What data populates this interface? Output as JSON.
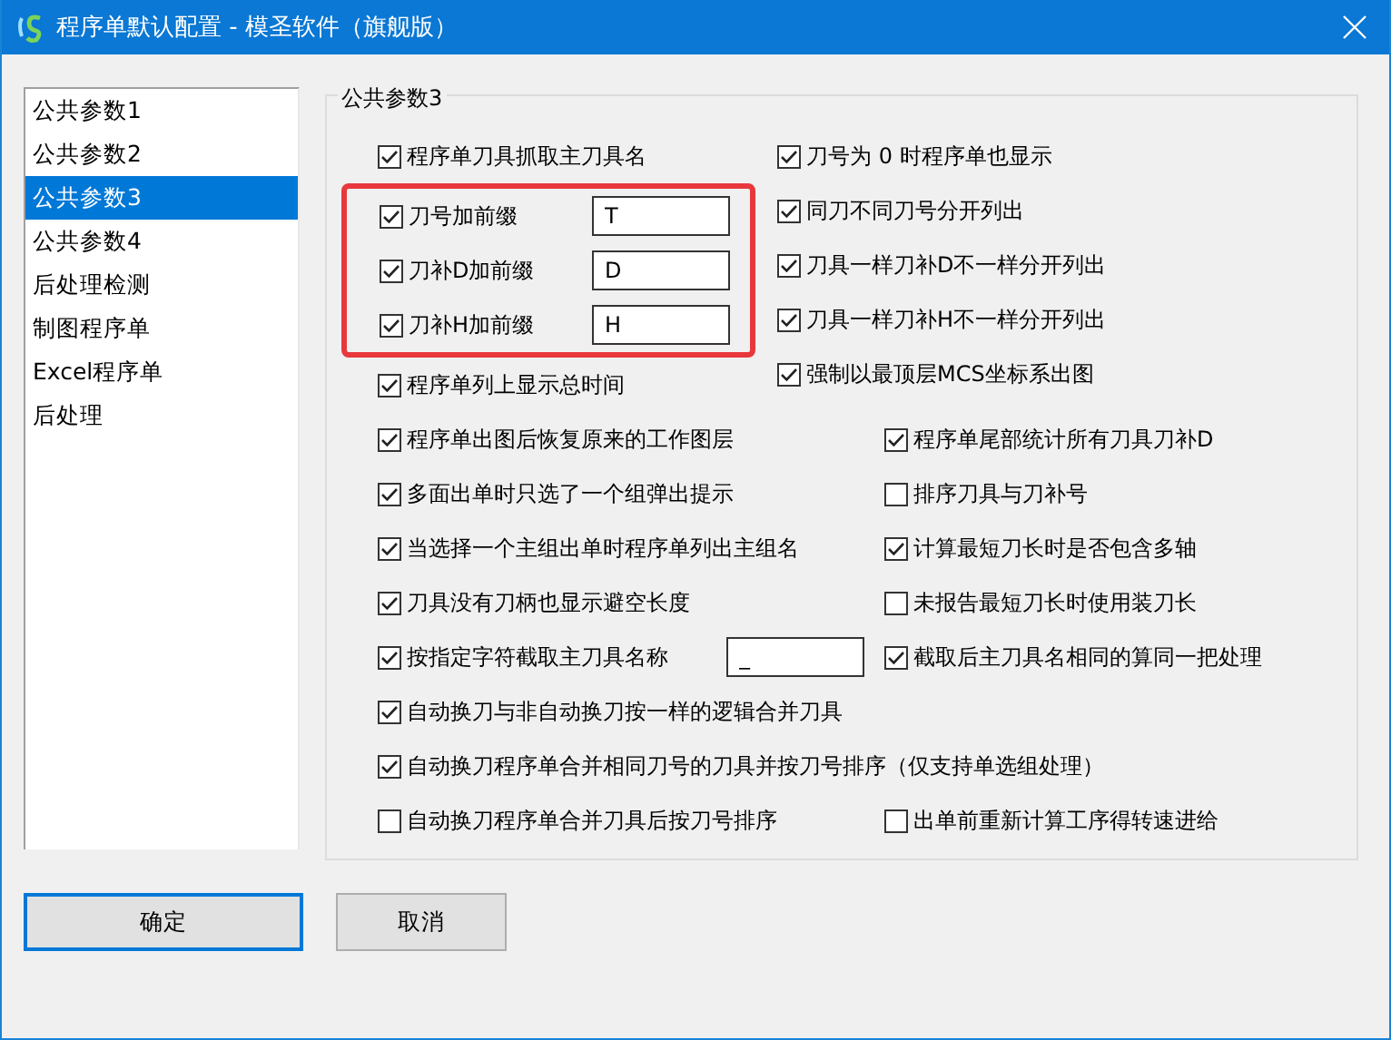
{
  "window": {
    "title": "程序单默认配置 - 模圣软件（旗舰版）"
  },
  "sidebar": {
    "items": [
      {
        "label": "公共参数1",
        "selected": false
      },
      {
        "label": "公共参数2",
        "selected": false
      },
      {
        "label": "公共参数3",
        "selected": true
      },
      {
        "label": "公共参数4",
        "selected": false
      },
      {
        "label": "后处理检测",
        "selected": false
      },
      {
        "label": "制图程序单",
        "selected": false
      },
      {
        "label": "Excel程序单",
        "selected": false
      },
      {
        "label": "后处理",
        "selected": false
      }
    ]
  },
  "group": {
    "title": "公共参数3",
    "top": {
      "left_before": [
        {
          "label": "程序单刀具抓取主刀具名",
          "checked": true
        }
      ],
      "prefix_box": {
        "outlined": true,
        "items": [
          {
            "label": "刀号加前缀",
            "checked": true,
            "value": "T"
          },
          {
            "label": "刀补D加前缀",
            "checked": true,
            "value": "D"
          },
          {
            "label": "刀补H加前缀",
            "checked": true,
            "value": "H"
          }
        ]
      },
      "left_after": [
        {
          "label": "程序单列上显示总时间",
          "checked": true
        }
      ],
      "right": [
        {
          "label": "刀号为 0 时程序单也显示",
          "checked": true
        },
        {
          "label": "同刀不同刀号分开列出",
          "checked": true
        },
        {
          "label": "刀具一样刀补D不一样分开列出",
          "checked": true
        },
        {
          "label": "刀具一样刀补H不一样分开列出",
          "checked": true
        },
        {
          "label": "强制以最顶层MCS坐标系出图",
          "checked": true
        }
      ]
    },
    "rows": [
      {
        "left": {
          "label": "程序单出图后恢复原来的工作图层",
          "checked": true
        },
        "right": {
          "label": "程序单尾部统计所有刀具刀补D",
          "checked": true
        }
      },
      {
        "left": {
          "label": "多面出单时只选了一个组弹出提示",
          "checked": true
        },
        "right": {
          "label": "排序刀具与刀补号",
          "checked": false
        }
      },
      {
        "left": {
          "label": "当选择一个主组出单时程序单列出主组名",
          "checked": true
        },
        "right": {
          "label": "计算最短刀长时是否包含多轴",
          "checked": true
        }
      },
      {
        "left": {
          "label": "刀具没有刀柄也显示避空长度",
          "checked": true
        },
        "right": {
          "label": "未报告最短刀长时使用装刀长",
          "checked": false
        }
      },
      {
        "left": {
          "label": "按指定字符截取主刀具名称",
          "checked": true,
          "value": "_"
        },
        "right": {
          "label": "截取后主刀具名相同的算同一把处理",
          "checked": true
        }
      },
      {
        "left": {
          "label": "自动换刀与非自动换刀按一样的逻辑合并刀具",
          "checked": true
        }
      },
      {
        "left": {
          "label": "自动换刀程序单合并相同刀号的刀具并按刀号排序（仅支持单选组处理）",
          "checked": true
        }
      },
      {
        "left": {
          "label": "自动换刀程序单合并刀具后按刀号排序",
          "checked": false
        },
        "right": {
          "label": "出单前重新计算工序得转速进给",
          "checked": false
        }
      }
    ]
  },
  "buttons": [
    {
      "label": "确定",
      "kind": "default"
    },
    {
      "label": "取消",
      "kind": "normal"
    }
  ]
}
